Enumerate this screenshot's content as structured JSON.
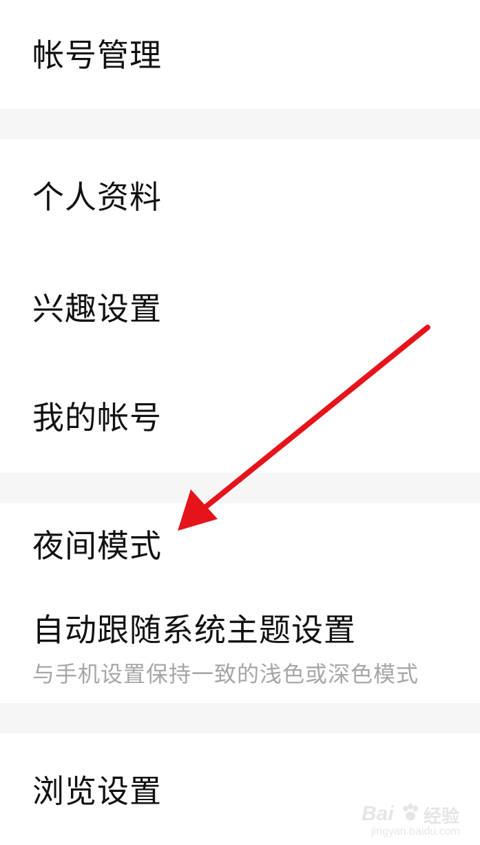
{
  "settings": {
    "account_management": "帐号管理",
    "profile": "个人资料",
    "interest_settings": "兴趣设置",
    "my_account": "我的帐号",
    "night_mode": "夜间模式",
    "auto_theme": {
      "label": "自动跟随系统主题设置",
      "subtitle": "与手机设置保持一致的浅色或深色模式"
    },
    "browse_settings": "浏览设置"
  },
  "annotation": {
    "arrow_color": "#e5141b"
  },
  "watermark": {
    "logo": "Bai",
    "brand": "经验",
    "domain": "jingyan.baidu.com"
  },
  "colors": {
    "background": "#ffffff",
    "section_gap": "#f6f6f7",
    "text_primary": "#111111",
    "text_secondary": "#a6a6a6"
  }
}
